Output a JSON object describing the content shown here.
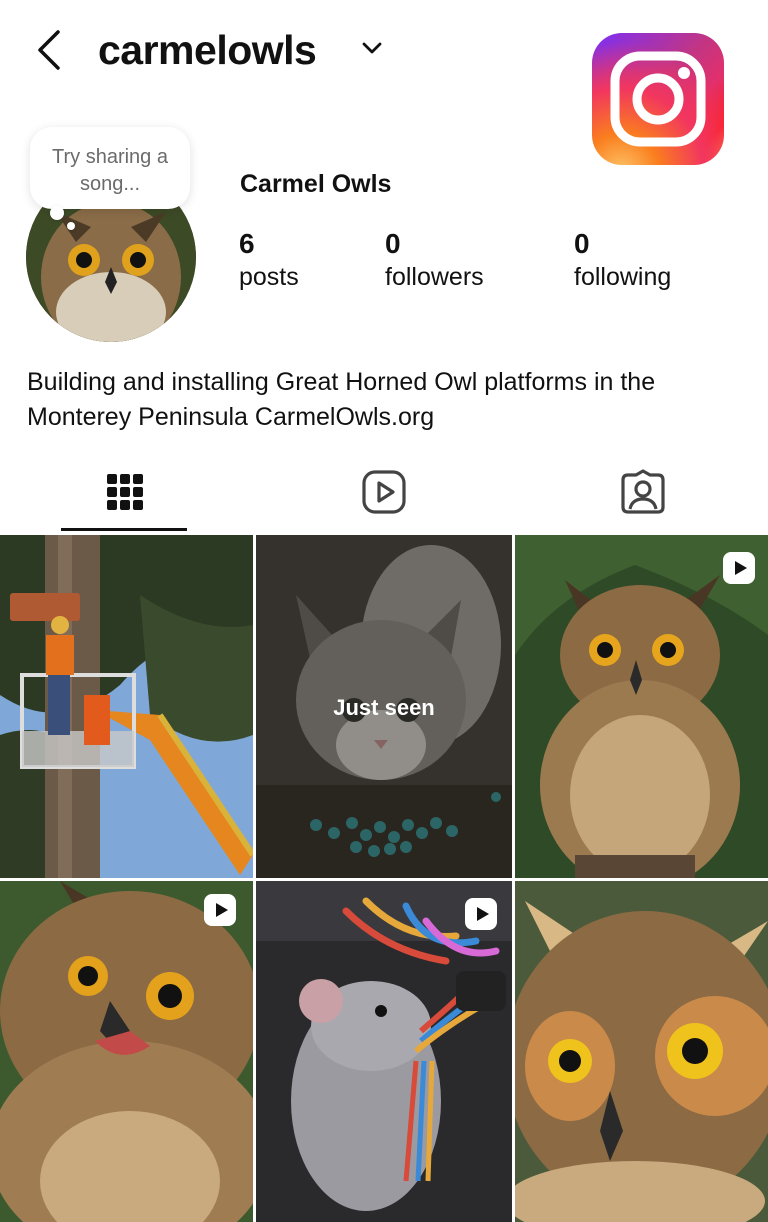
{
  "header": {
    "username": "carmelowls",
    "back_icon": "chevron-left-icon",
    "dropdown_icon": "chevron-down-icon",
    "logo_icon": "instagram-logo"
  },
  "profile": {
    "display_name": "Carmel Owls",
    "note_bubble": "Try sharing a song...",
    "stats": [
      {
        "value": "6",
        "label": "posts"
      },
      {
        "value": "0",
        "label": "followers"
      },
      {
        "value": "0",
        "label": "following"
      }
    ],
    "bio": "Building and installing Great Horned Owl platforms in the Monterey Peninsula CarmelOwls.org"
  },
  "tabs": [
    {
      "icon": "grid-icon",
      "active": true
    },
    {
      "icon": "reels-icon",
      "active": false
    },
    {
      "icon": "tagged-icon",
      "active": false
    }
  ],
  "posts": [
    {
      "subject": "worker in lift installing owl platform in tree",
      "reel": false
    },
    {
      "subject": "kitten with blue pellets",
      "reel": false,
      "overlay": "Just seen"
    },
    {
      "subject": "great horned owl on branch",
      "reel": true
    },
    {
      "subject": "great horned owl closeup open beak",
      "reel": true
    },
    {
      "subject": "rat chewing wires",
      "reel": true
    },
    {
      "subject": "great horned owl face closeup",
      "reel": false
    }
  ],
  "colors": {
    "text": "#111111",
    "secondary_text": "#6b6b6b",
    "background": "#ffffff",
    "tab_icon": "#444444"
  }
}
